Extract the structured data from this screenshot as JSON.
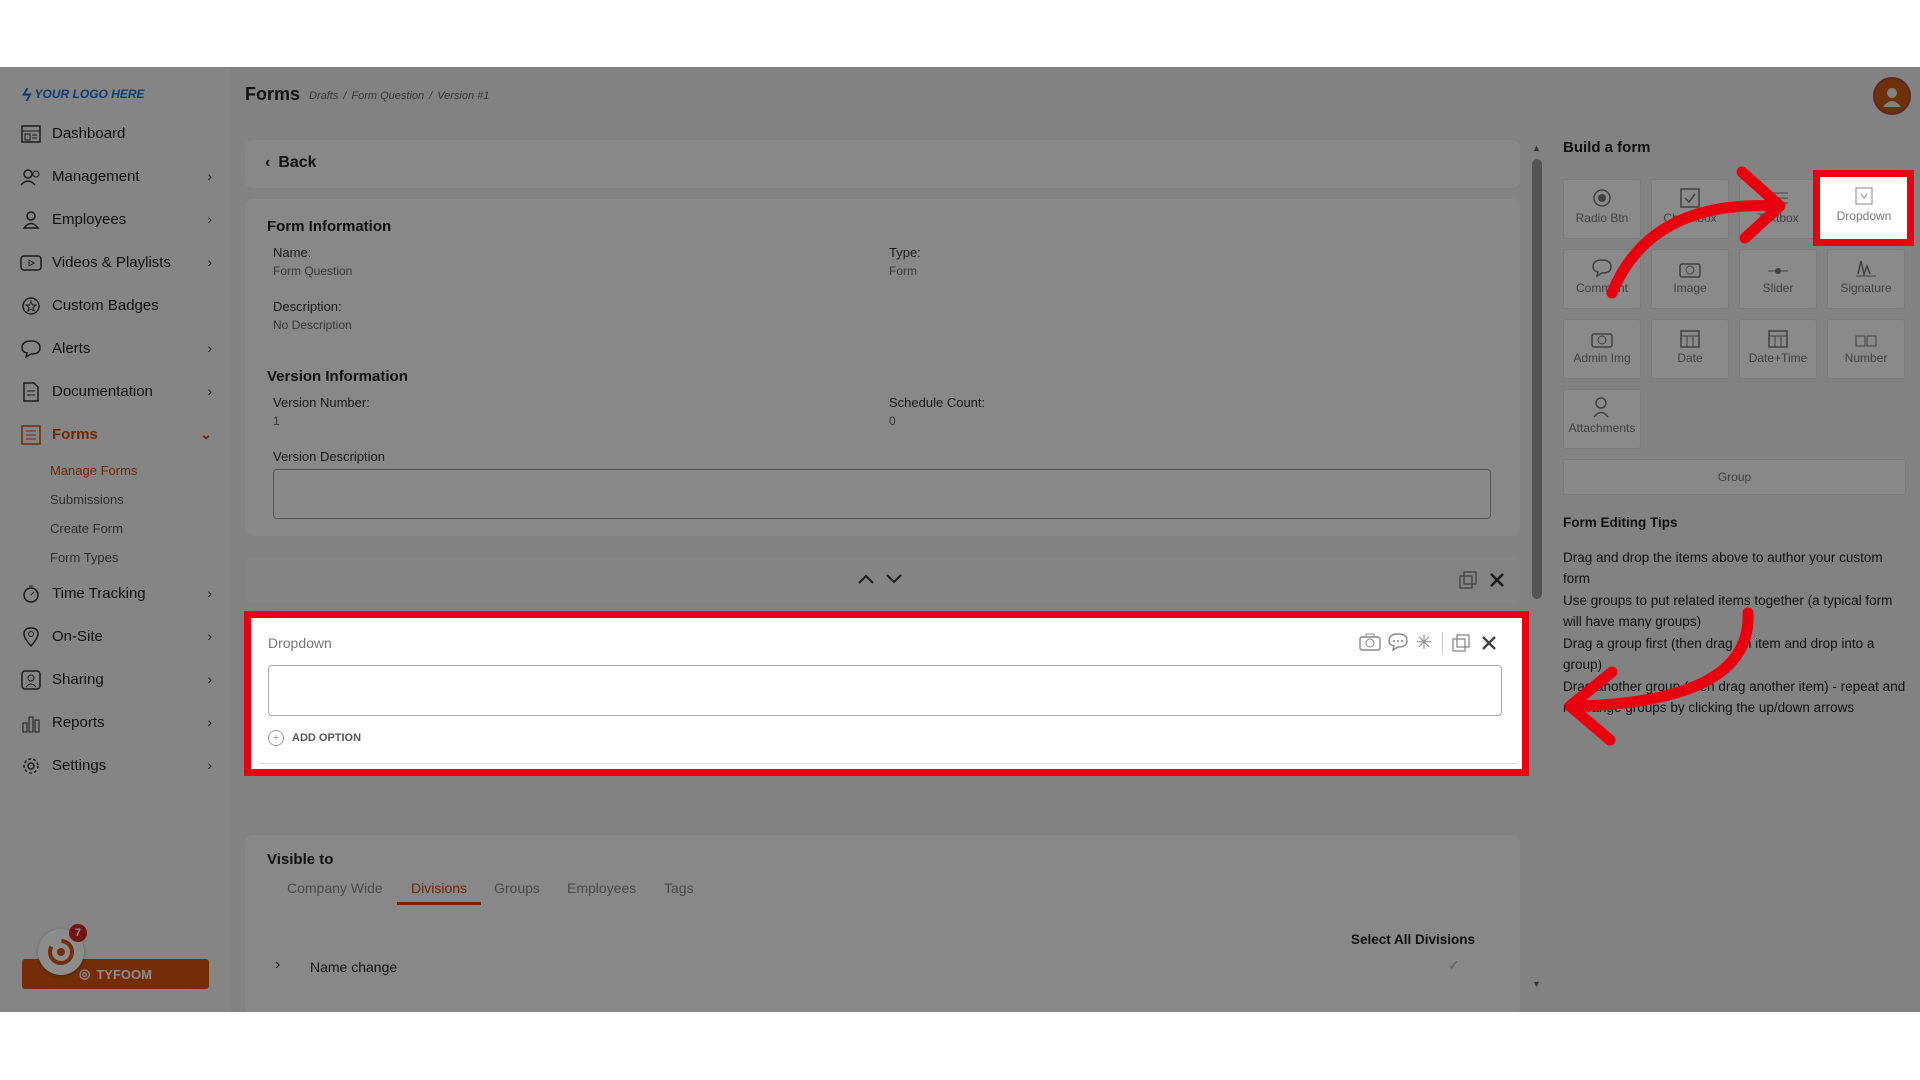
{
  "brand": {
    "logo_text": "YOUR LOGO HERE",
    "button_label": "TYFOOM",
    "badge_count": "7"
  },
  "header": {
    "title": "Forms",
    "breadcrumb": [
      "Drafts",
      "Form Question",
      "Version #1"
    ]
  },
  "sidebar": {
    "items": [
      {
        "label": "Dashboard",
        "icon": "dashboard-icon",
        "chevron": false
      },
      {
        "label": "Management",
        "icon": "management-icon",
        "chevron": true
      },
      {
        "label": "Employees",
        "icon": "person-icon",
        "chevron": true
      },
      {
        "label": "Videos & Playlists",
        "icon": "video-icon",
        "chevron": true
      },
      {
        "label": "Custom Badges",
        "icon": "badge-icon",
        "chevron": false
      },
      {
        "label": "Alerts",
        "icon": "chat-icon",
        "chevron": true
      },
      {
        "label": "Documentation",
        "icon": "document-icon",
        "chevron": true
      },
      {
        "label": "Forms",
        "icon": "list-icon",
        "chevron": true,
        "active": true
      },
      {
        "label": "Time Tracking",
        "icon": "stopwatch-icon",
        "chevron": true
      },
      {
        "label": "On-Site",
        "icon": "pin-icon",
        "chevron": true
      },
      {
        "label": "Sharing",
        "icon": "share-icon",
        "chevron": true
      },
      {
        "label": "Reports",
        "icon": "bar-chart-icon",
        "chevron": true
      },
      {
        "label": "Settings",
        "icon": "gear-icon",
        "chevron": true
      }
    ],
    "forms_sub": [
      "Manage Forms",
      "Submissions",
      "Create Form",
      "Form Types"
    ]
  },
  "main": {
    "back_label": "Back",
    "form_info": {
      "heading": "Form Information",
      "name_label": "Name:",
      "name_value": "Form Question",
      "type_label": "Type:",
      "type_value": "Form",
      "description_label": "Description:",
      "description_value": "No Description"
    },
    "version_info": {
      "heading": "Version Information",
      "version_label": "Version Number:",
      "version_value": "1",
      "schedule_label": "Schedule Count:",
      "schedule_value": "0",
      "description_label": "Version Description",
      "description_value": ""
    },
    "dropdown_item": {
      "label": "Dropdown",
      "value": "",
      "add_option": "ADD OPTION"
    },
    "visible_to": {
      "heading": "Visible to",
      "tabs": [
        "Company Wide",
        "Divisions",
        "Groups",
        "Employees",
        "Tags"
      ],
      "active_tab": "Divisions",
      "select_all": "Select All Divisions",
      "rows": [
        "Name change"
      ]
    }
  },
  "builder": {
    "heading": "Build a form",
    "widgets": [
      {
        "label": "Radio Btn",
        "icon": "radio-icon"
      },
      {
        "label": "Checkbox",
        "icon": "checkbox-icon"
      },
      {
        "label": "Textbox",
        "icon": "textbox-icon"
      },
      {
        "label": "Dropdown",
        "icon": "dropdown-icon"
      },
      {
        "label": "Comment",
        "icon": "comment-icon"
      },
      {
        "label": "Image",
        "icon": "camera-icon"
      },
      {
        "label": "Slider",
        "icon": "slider-icon"
      },
      {
        "label": "Signature",
        "icon": "signature-icon"
      },
      {
        "label": "Admin Img",
        "icon": "admin-image-icon"
      },
      {
        "label": "Date",
        "icon": "calendar-icon"
      },
      {
        "label": "Date+Time",
        "icon": "calendar-clock-icon"
      },
      {
        "label": "Number",
        "icon": "number-icon"
      },
      {
        "label": "Attachments",
        "icon": "attachment-icon"
      }
    ],
    "group_label": "Group",
    "tips_heading": "Form Editing Tips",
    "tips": [
      "Drag and drop the items above to author your custom form",
      "Use groups to put related items together (a typical form will have many groups)",
      "Drag a group first (then drag an item and drop into a group)",
      "Drag another group (then drag another item) - repeat and rearrange groups by clicking the up/down arrows"
    ]
  },
  "colors": {
    "accent": "#c84b0f",
    "highlight": "#e8000e",
    "brand_button": "#d3530f",
    "overlay": "rgba(0,0,0,0.45)"
  }
}
